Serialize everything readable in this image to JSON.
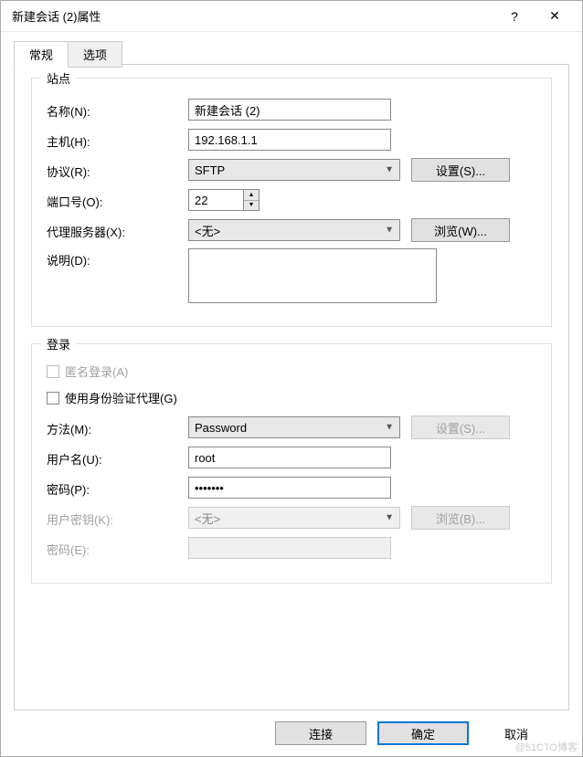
{
  "title": "新建会话 (2)属性",
  "help_glyph": "?",
  "close_glyph": "✕",
  "tabs": {
    "general": "常规",
    "options": "选项"
  },
  "site": {
    "legend": "站点",
    "name_label": "名称(N):",
    "name_value": "新建会话 (2)",
    "host_label": "主机(H):",
    "host_value": "192.168.1.1",
    "protocol_label": "协议(R):",
    "protocol_value": "SFTP",
    "settings_btn": "设置(S)...",
    "port_label": "端口号(O):",
    "port_value": "22",
    "proxy_label": "代理服务器(X):",
    "proxy_value": "<无>",
    "browse_btn": "浏览(W)...",
    "desc_label": "说明(D):",
    "desc_value": ""
  },
  "login": {
    "legend": "登录",
    "anon_label": "匿名登录(A)",
    "agent_label": "使用身份验证代理(G)",
    "method_label": "方法(M):",
    "method_value": "Password",
    "settings_btn": "设置(S)...",
    "user_label": "用户名(U):",
    "user_value": "root",
    "pass_label": "密码(P):",
    "pass_value": "1234567",
    "key_label": "用户密钥(K):",
    "key_value": "<无>",
    "browse_btn": "浏览(B)...",
    "pass2_label": "密码(E):",
    "pass2_value": ""
  },
  "footer": {
    "connect": "连接",
    "ok": "确定",
    "cancel": "取消"
  },
  "watermark": "@51CTO博客"
}
